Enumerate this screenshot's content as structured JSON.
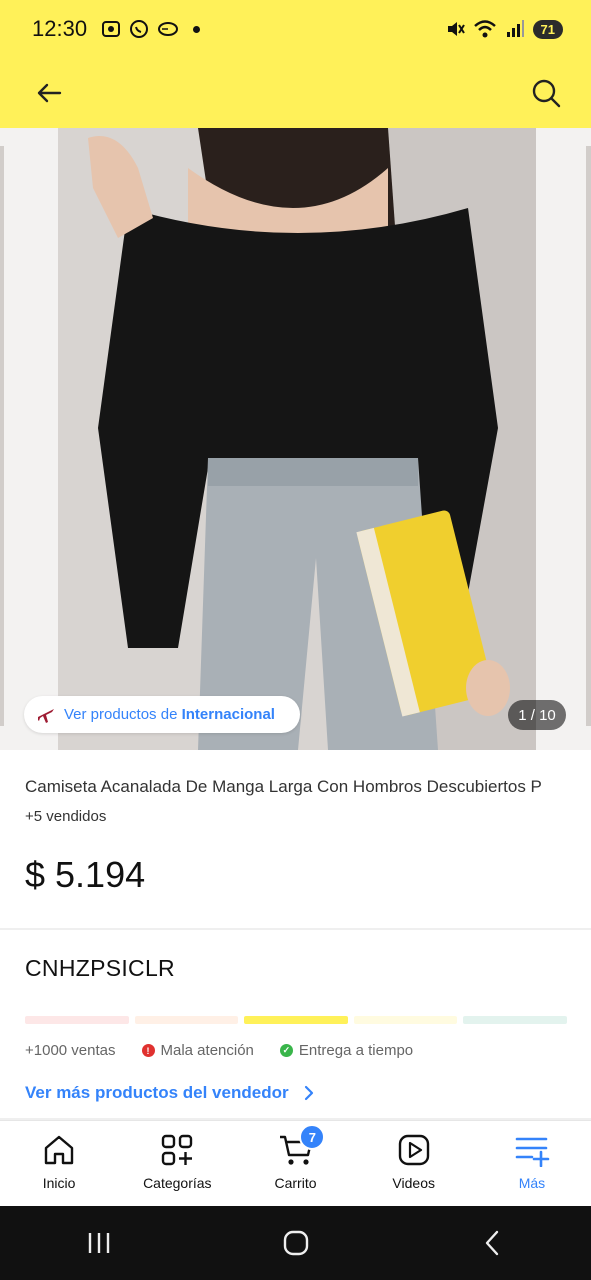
{
  "status_bar": {
    "time": "12:30",
    "battery": "71",
    "icons": [
      "screen-record-icon",
      "whatsapp-icon",
      "game-icon",
      "mute-icon",
      "wifi-icon",
      "signal-icon"
    ]
  },
  "app_bar": {
    "back_icon": "arrow-left-icon",
    "search_icon": "search-icon"
  },
  "gallery": {
    "intl_prefix": "Ver productos de",
    "intl_brand": "Internacional",
    "counter": "1 / 10"
  },
  "product": {
    "title": "Camiseta Acanalada De Manga Larga Con Hombros Descubiertos P",
    "sold": "+5 vendidos",
    "price": "$ 5.194"
  },
  "seller": {
    "name": "CNHZPSICLR",
    "reputation_colors": [
      "#fde7e7",
      "#fff0e6",
      "#fff159",
      "#fffbe0",
      "#e3f3ee"
    ],
    "reputation_active_index": 2,
    "sales": "+1000 ventas",
    "attention": "Mala atención",
    "delivery": "Entrega a tiempo",
    "more_link": "Ver más productos del vendedor"
  },
  "bottom_nav": {
    "items": [
      {
        "label": "Inicio",
        "icon": "home-icon"
      },
      {
        "label": "Categorías",
        "icon": "categories-icon"
      },
      {
        "label": "Carrito",
        "icon": "cart-icon",
        "badge": "7"
      },
      {
        "label": "Videos",
        "icon": "play-icon"
      },
      {
        "label": "Más",
        "icon": "menu-plus-icon"
      }
    ]
  },
  "colors": {
    "brand_yellow": "#fff159",
    "link_blue": "#3483fa",
    "bad_red": "#e0312f",
    "good_green": "#39b54a"
  }
}
